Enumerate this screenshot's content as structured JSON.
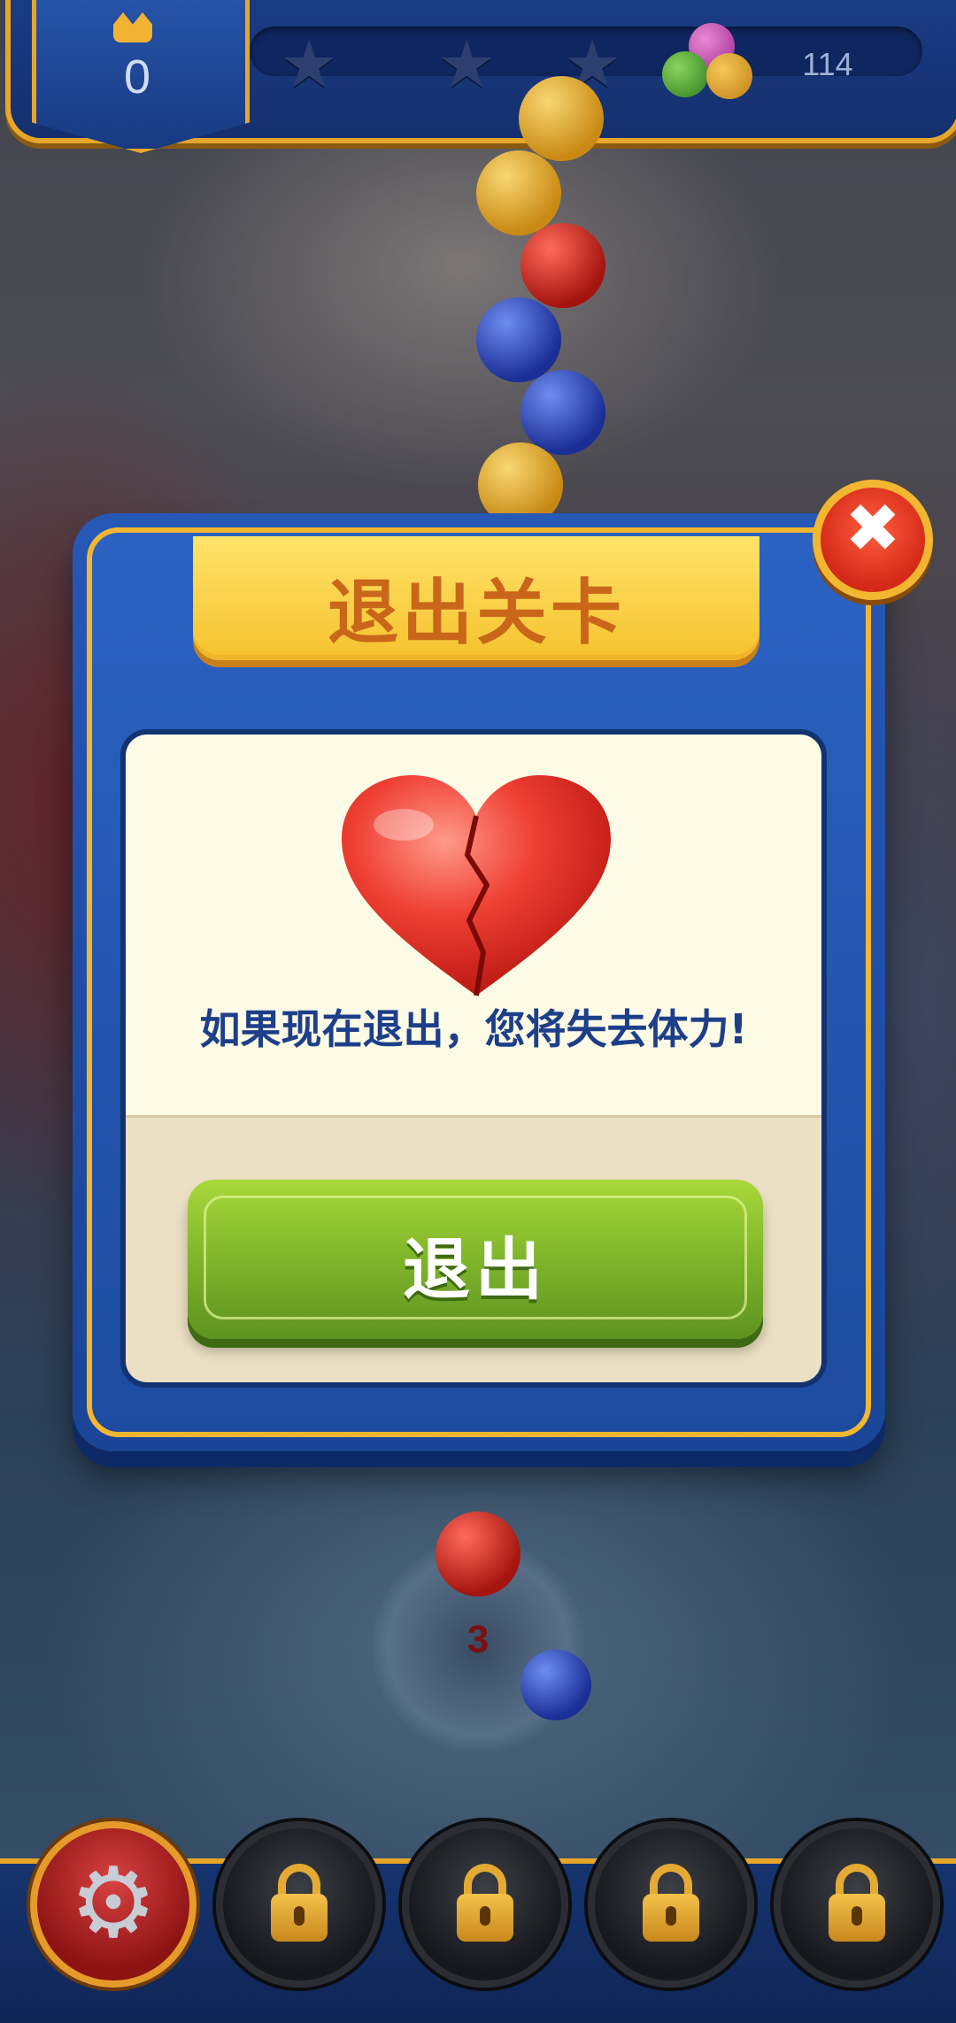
{
  "hud": {
    "score": "0",
    "stars": [
      "★",
      "★",
      "★"
    ],
    "ball_count": "114",
    "crown_icon": "crown-icon",
    "balls_icon": "colored-balls-icon"
  },
  "dialog": {
    "title": "退出关卡",
    "message": "如果现在退出，您将失去体力!",
    "exit_label": "退出",
    "close_glyph": "✖",
    "heart_icon": "broken-heart-icon"
  },
  "shooter": {
    "count": "3"
  },
  "bottom_bar": {
    "settings_icon": "gear-icon",
    "settings_glyph": "⚙",
    "locked_slots": 4,
    "lock_icon": "lock-icon"
  },
  "colors": {
    "dialog_blue": "#2658b6",
    "gold": "#f2b630",
    "title_text": "#c9661a",
    "message_text": "#1d3f8a",
    "exit_green": "#7fb52a",
    "close_red": "#d42818"
  }
}
